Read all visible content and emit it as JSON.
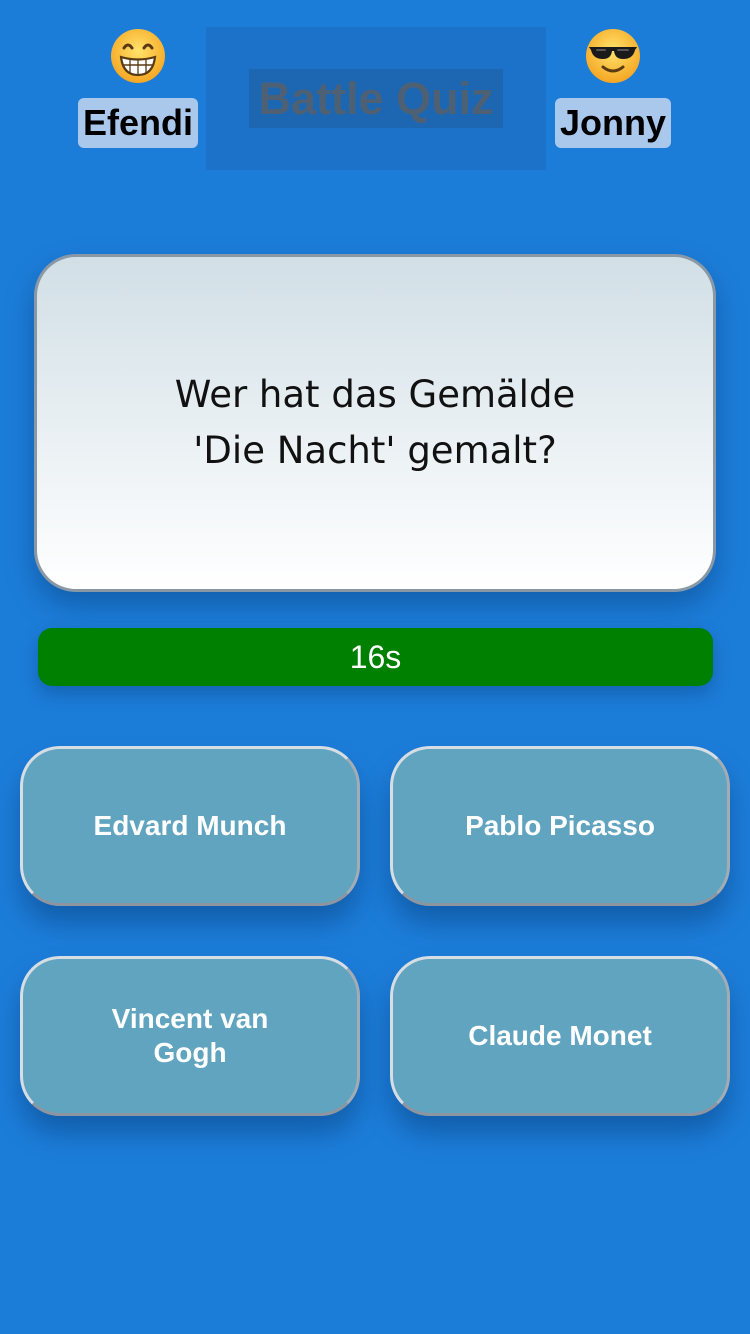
{
  "header": {
    "title": "Battle Quiz"
  },
  "players": [
    {
      "name": "Efendi",
      "avatar_icon": "grinning-face-emoji-icon"
    },
    {
      "name": "Jonny",
      "avatar_icon": "sunglasses-face-emoji-icon"
    }
  ],
  "question": {
    "text": "Wer hat das Gemälde 'Die Nacht' gemalt?"
  },
  "timer": {
    "label": "16s",
    "remaining_fraction": 1.0,
    "bar_color": "#008000"
  },
  "answers": [
    {
      "label": "Edvard Munch"
    },
    {
      "label": "Pablo Picasso"
    },
    {
      "label": "Vincent van Gogh"
    },
    {
      "label": "Claude Monet"
    }
  ],
  "colors": {
    "background": "#1c7dd9",
    "answer_button": "#61a4bf",
    "name_badge": "#a9c8ec"
  }
}
